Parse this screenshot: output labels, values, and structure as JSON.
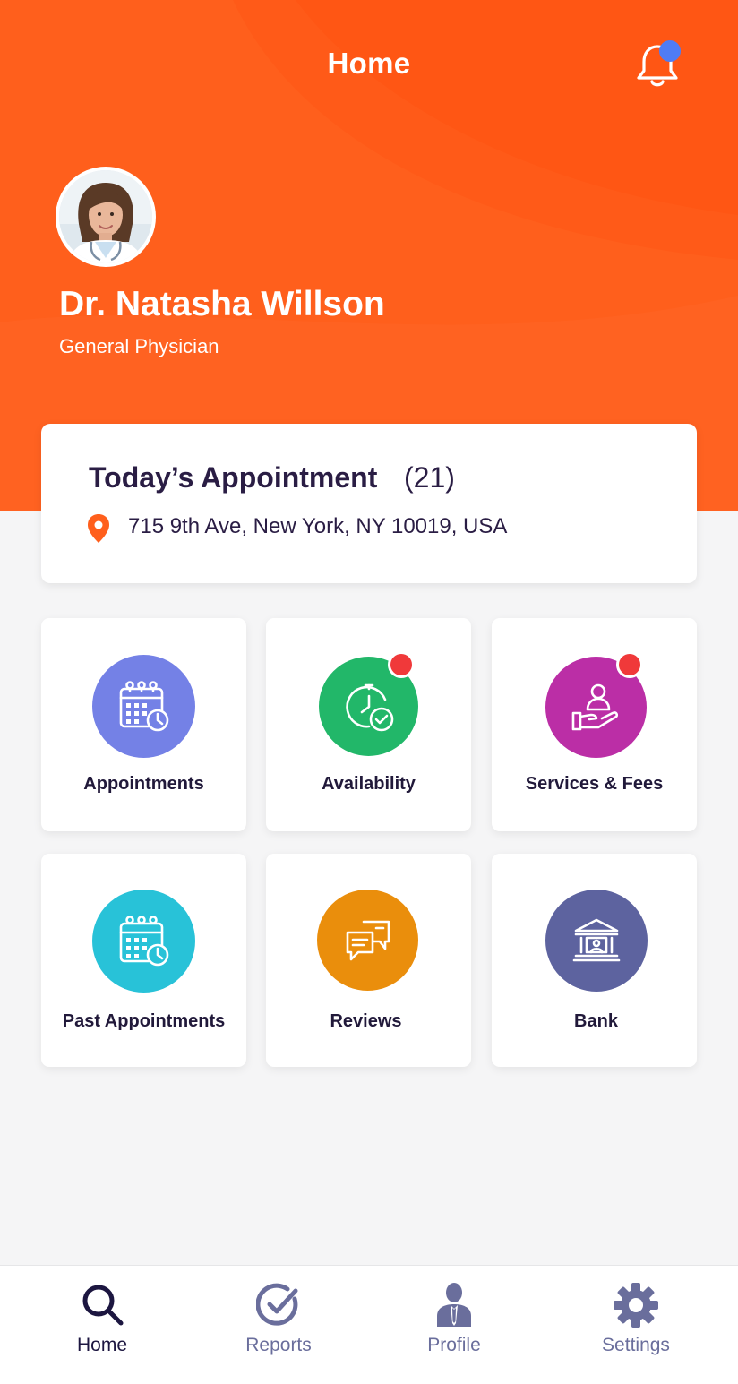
{
  "header": {
    "title": "Home",
    "notification_icon": "bell-icon",
    "notification_dot_color": "#4f7cf5",
    "background_color": "#ff5f1c"
  },
  "profile": {
    "name": "Dr. Natasha Willson",
    "specialty": "General Physician"
  },
  "appointment_card": {
    "title": "Today’s Appointment",
    "count": "(21)",
    "location_icon": "location-pin-icon",
    "address": "715 9th Ave, New York, NY 10019, USA"
  },
  "tiles": [
    {
      "label": "Appointments",
      "icon": "calendar-clock-icon",
      "color": "#7481e6",
      "badge": false
    },
    {
      "label": "Availability",
      "icon": "clock-check-icon",
      "color": "#22b769",
      "badge": true
    },
    {
      "label": "Services & Fees",
      "icon": "hand-person-icon",
      "color": "#bb2ea6",
      "badge": true
    },
    {
      "label": "Past Appointments",
      "icon": "calendar-clock-icon",
      "color": "#28c2d8",
      "badge": false
    },
    {
      "label": "Reviews",
      "icon": "chat-bubbles-icon",
      "color": "#ea8e0c",
      "badge": false
    },
    {
      "label": "Bank",
      "icon": "bank-icon",
      "color": "#5d639f",
      "badge": false
    }
  ],
  "bottom_nav": {
    "items": [
      {
        "label": "Home",
        "icon": "search-icon",
        "active": true
      },
      {
        "label": "Reports",
        "icon": "check-circle-icon",
        "active": false
      },
      {
        "label": "Profile",
        "icon": "person-icon",
        "active": false
      },
      {
        "label": "Settings",
        "icon": "gear-icon",
        "active": false
      }
    ],
    "active_color": "#1c1640",
    "inactive_color": "#6a6e9c"
  }
}
